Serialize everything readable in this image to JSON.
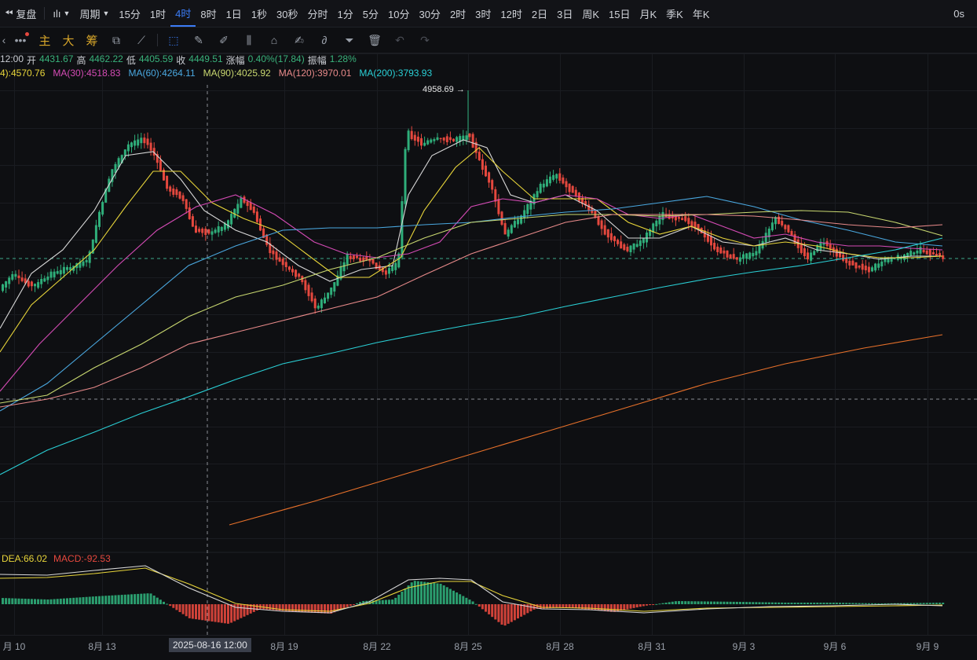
{
  "topbar": {
    "replay_label": "复盘",
    "period_label": "周期",
    "intervals": [
      "15分",
      "1时",
      "4时",
      "8时",
      "1日",
      "1秒",
      "30秒",
      "分时",
      "1分",
      "5分",
      "10分",
      "30分",
      "2时",
      "3时",
      "12时",
      "2日",
      "3日",
      "周K",
      "15日",
      "月K",
      "季K",
      "年K"
    ],
    "active_interval": "4时",
    "latency": "0s"
  },
  "toolbar": {
    "main_label": "主",
    "large_label": "大",
    "chips_label": "筹"
  },
  "ohlc": {
    "time_fragment": "12:00",
    "open_label": "开",
    "open": "4431.67",
    "high_label": "高",
    "high": "4462.22",
    "low_label": "低",
    "low": "4405.59",
    "close_label": "收",
    "close": "4449.51",
    "change_label": "涨幅",
    "change": "0.40%(17.84)",
    "amplitude_label": "振幅",
    "amplitude": "1.28%"
  },
  "ma": [
    {
      "label": "4):4570.76",
      "color": "#e8d53a"
    },
    {
      "label": "MA(30):4518.83",
      "color": "#d54bb5"
    },
    {
      "label": "MA(60):4264.11",
      "color": "#4aa8e0"
    },
    {
      "label": "MA(90):4025.92",
      "color": "#c9d870"
    },
    {
      "label": "MA(120):3970.01",
      "color": "#e88a8a"
    },
    {
      "label": "MA(200):3793.93",
      "color": "#2ad0d6"
    }
  ],
  "peak_label": "4958.69 →",
  "macd": {
    "dea": "DEA:66.02",
    "macd": "MACD:-92.53"
  },
  "xaxis": {
    "labels": [
      "月 10",
      "8月 13",
      "8月 19",
      "8月 22",
      "8月 25",
      "8月 28",
      "8月 31",
      "9月 3",
      "9月 6",
      "9月 9"
    ],
    "crosshair_time": "2025-08-16 12:00"
  },
  "colors": {
    "up": "#2fae7a",
    "down": "#e5483e",
    "accent": "#3b7cf6",
    "background": "#0e0f12"
  },
  "icons": [
    "rewind-icon",
    "candle-type-icon",
    "more-icon",
    "cursor-icon",
    "ruler-icon",
    "pen-icon",
    "candles-icon",
    "lock-icon",
    "note-icon",
    "link-icon",
    "filter-icon",
    "trash-icon",
    "undo-icon",
    "redo-icon"
  ]
}
